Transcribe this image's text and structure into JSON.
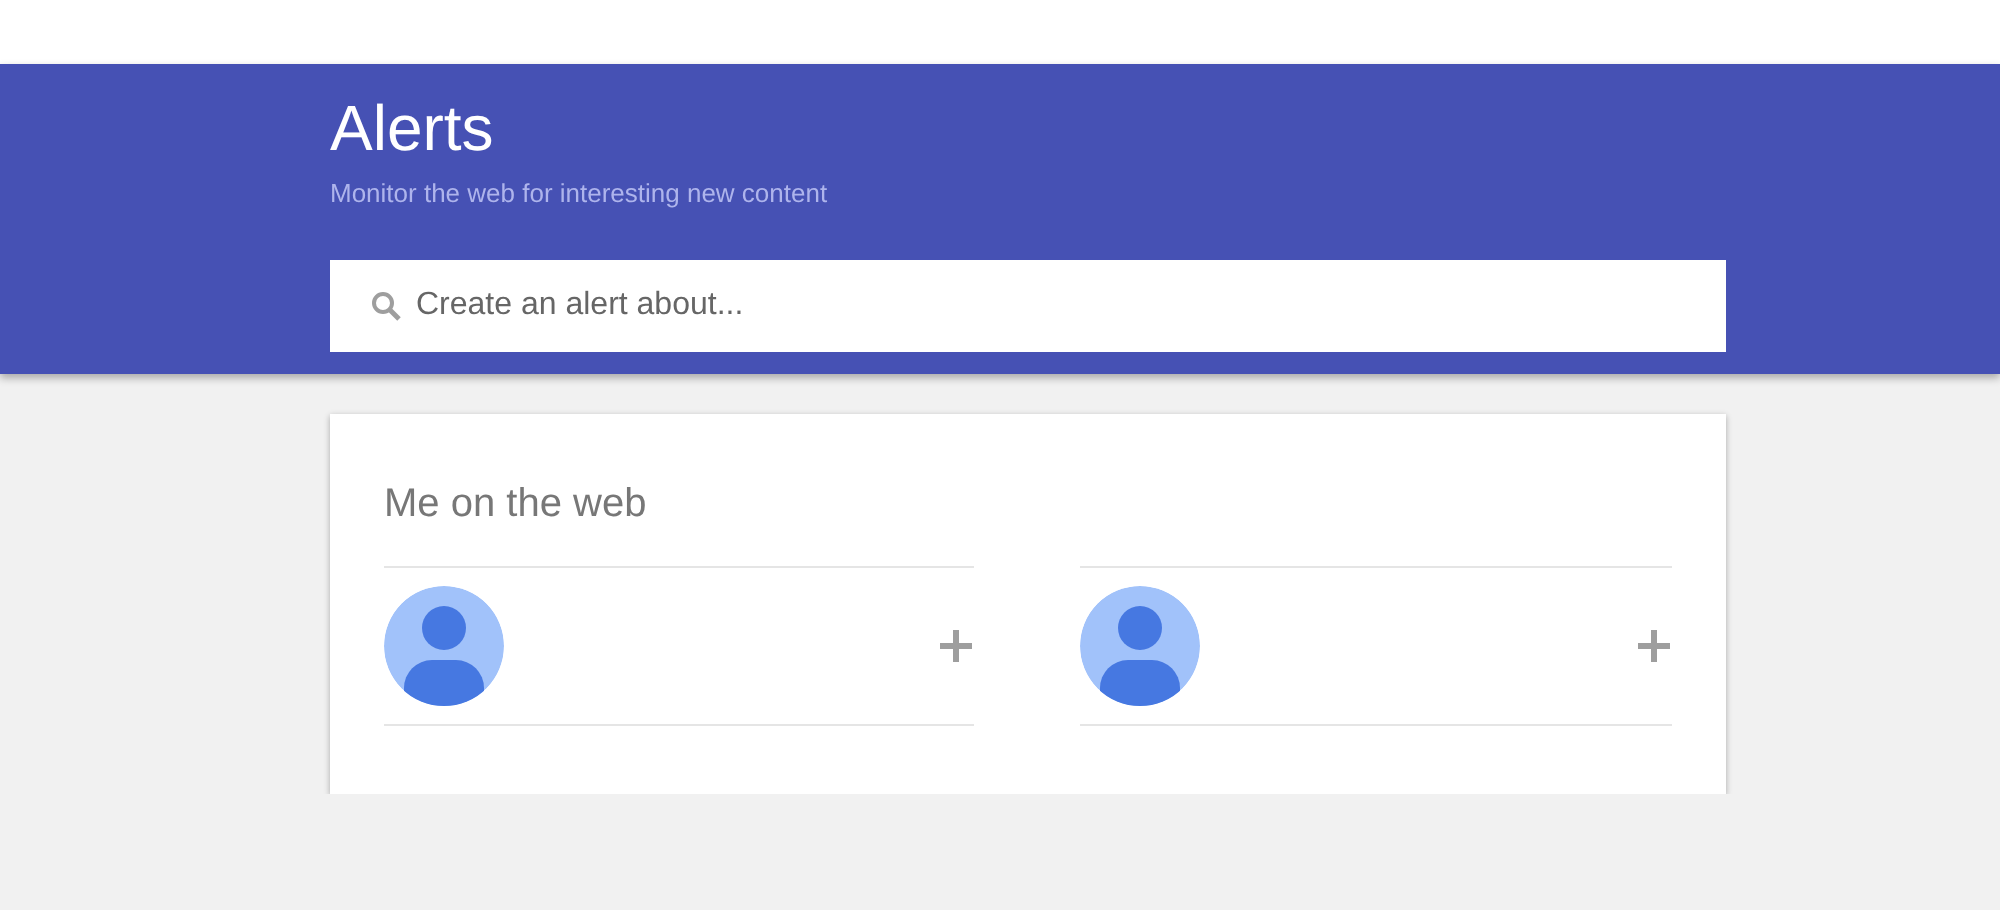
{
  "header": {
    "title": "Alerts",
    "subtitle": "Monitor the web for interesting new content"
  },
  "search": {
    "placeholder": "Create an alert about..."
  },
  "card": {
    "title": "Me on the web",
    "profiles": [
      {
        "kind": "avatar"
      },
      {
        "kind": "avatar"
      }
    ]
  }
}
